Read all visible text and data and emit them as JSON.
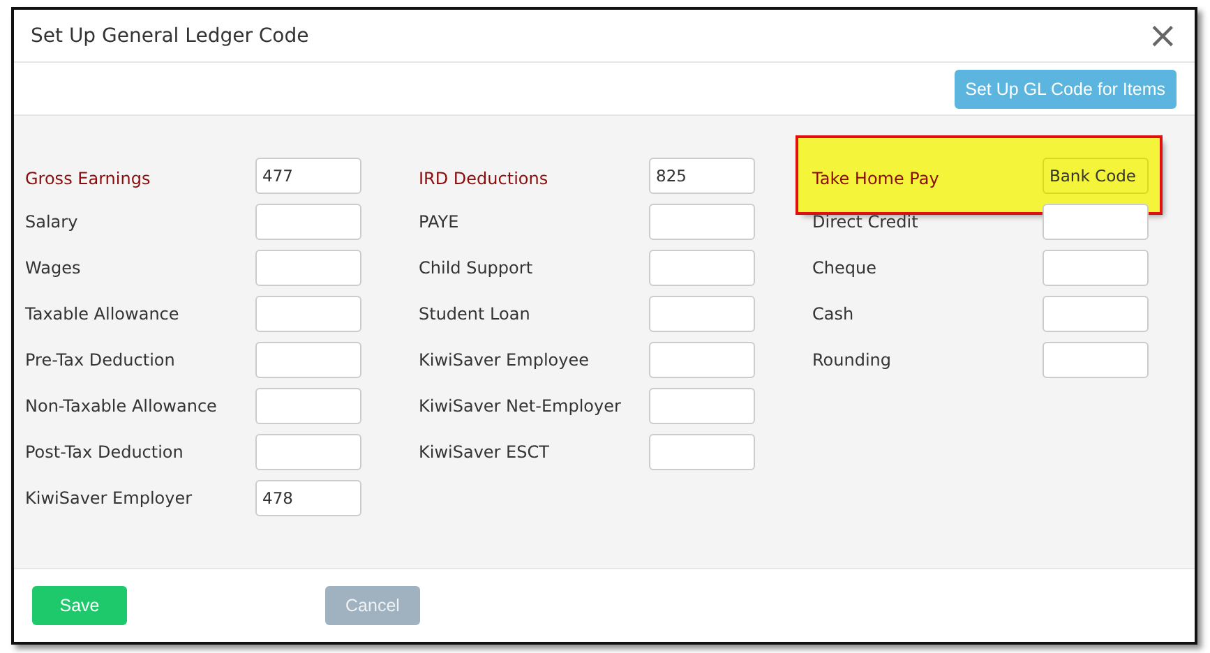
{
  "dialog": {
    "title": "Set Up General Ledger Code",
    "close": "×"
  },
  "toolbar": {
    "button": "Set Up GL Code for Items"
  },
  "columns": [
    {
      "header": {
        "label": "Gross Earnings",
        "value": "477",
        "highlighted": false
      },
      "items": [
        {
          "label": "Salary"
        },
        {
          "label": "Wages"
        },
        {
          "label": "Taxable Allowance"
        },
        {
          "label": "Pre-Tax Deduction"
        },
        {
          "label": "Non-Taxable Allowance"
        },
        {
          "label": "Post-Tax Deduction"
        },
        {
          "label": "KiwiSaver Employer",
          "value": "478"
        }
      ]
    },
    {
      "header": {
        "label": "IRD Deductions",
        "value": "825",
        "highlighted": false
      },
      "items": [
        {
          "label": "PAYE"
        },
        {
          "label": "Child Support"
        },
        {
          "label": "Student Loan"
        },
        {
          "label": "KiwiSaver Employee"
        },
        {
          "label": "KiwiSaver Net-Employer"
        },
        {
          "label": "KiwiSaver ESCT"
        }
      ]
    },
    {
      "header": {
        "label": "Take Home Pay",
        "value": "Bank Code",
        "highlighted": true
      },
      "items": [
        {
          "label": "Direct Credit"
        },
        {
          "label": "Cheque"
        },
        {
          "label": "Cash"
        },
        {
          "label": "Rounding"
        }
      ]
    }
  ],
  "footer": [
    {
      "label": "Save",
      "kind": "primary",
      "disabled": false
    },
    {
      "label": "Cancel",
      "kind": "secondary",
      "disabled": true
    }
  ]
}
